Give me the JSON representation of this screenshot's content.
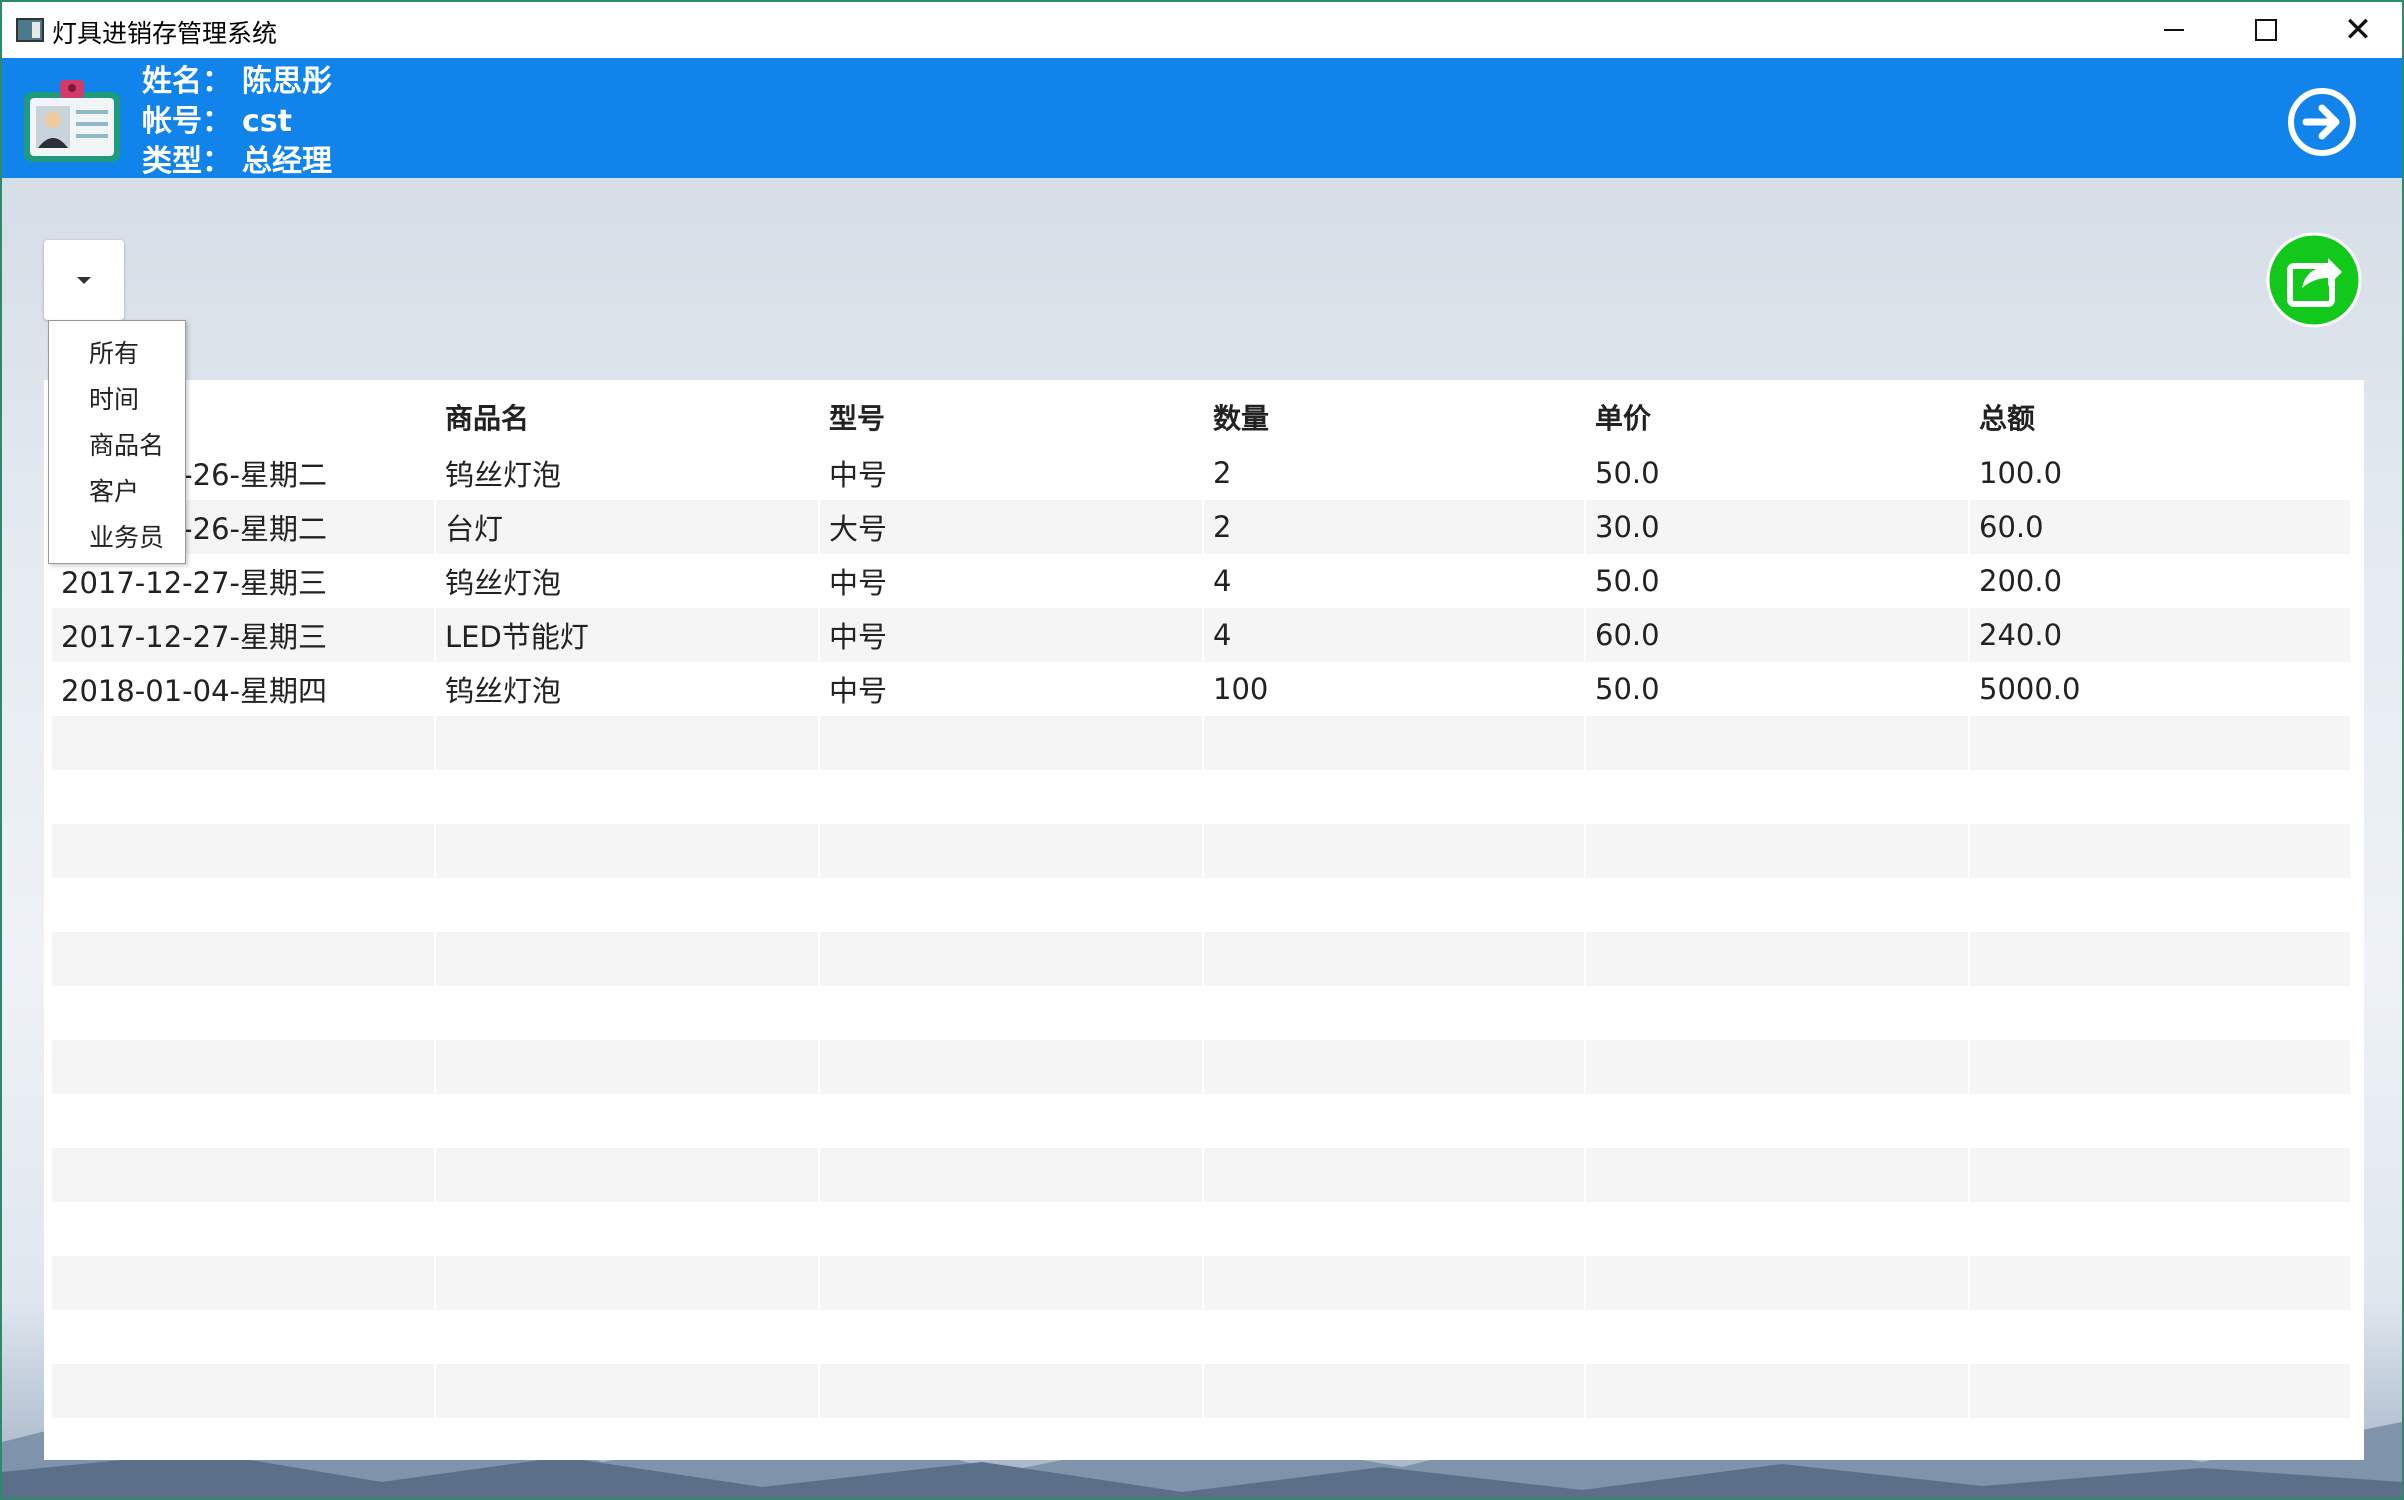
{
  "window": {
    "title": "灯具进销存管理系统",
    "minimize": "",
    "maximize": "",
    "close": "✕"
  },
  "header": {
    "name_label": "姓名：",
    "name_value": "陈思彤",
    "account_label": "帐号：",
    "account_value": "cst",
    "type_label": "类型：",
    "type_value": "总经理"
  },
  "filter": {
    "selected": "",
    "options": [
      "所有",
      "时间",
      "商品名",
      "客户",
      "业务员"
    ]
  },
  "table": {
    "columns": [
      "",
      "商品名",
      "型号",
      "数量",
      "单价",
      "总额"
    ],
    "rows": [
      [
        "2017-12-26-星期二",
        "钨丝灯泡",
        "中号",
        "2",
        "50.0",
        "100.0"
      ],
      [
        "2017-12-26-星期二",
        "台灯",
        "大号",
        "2",
        "30.0",
        "60.0"
      ],
      [
        "2017-12-27-星期三",
        "钨丝灯泡",
        "中号",
        "4",
        "50.0",
        "200.0"
      ],
      [
        "2017-12-27-星期三",
        "LED节能灯",
        "中号",
        "4",
        "60.0",
        "240.0"
      ],
      [
        "2018-01-04-星期四",
        "钨丝灯泡",
        "中号",
        "100",
        "50.0",
        "5000.0"
      ]
    ],
    "empty_rows": 13
  },
  "colors": {
    "header_bg": "#1184ec",
    "export_green": "#12c81a",
    "row_alt": "#f5f5f5"
  },
  "icons": {
    "badge": "id-badge-icon",
    "logout": "arrow-right-circle-icon",
    "export": "share-export-icon"
  }
}
